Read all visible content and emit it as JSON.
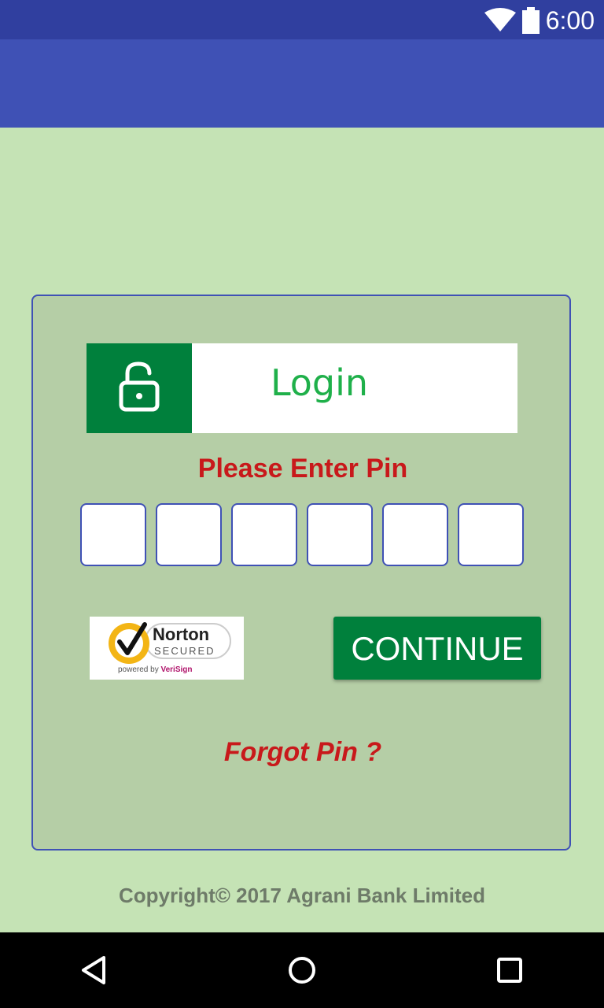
{
  "status_bar": {
    "time": "6:00"
  },
  "login": {
    "title": "Login"
  },
  "pin": {
    "prompt": "Please Enter Pin",
    "boxes": [
      "",
      "",
      "",
      "",
      "",
      ""
    ]
  },
  "norton": {
    "brand": "Norton",
    "secured": "SECURED",
    "powered_by": "powered by",
    "partner": "VeriSign"
  },
  "actions": {
    "continue_label": "CONTINUE",
    "forgot_label": "Forgot Pin ?"
  },
  "footer": {
    "copyright": "Copyright© 2017 Agrani Bank Limited"
  },
  "colors": {
    "primary": "#3f51b5",
    "primary_dark": "#303f9f",
    "green": "#00803c",
    "accent_red": "#c8191b",
    "background": "#c5e3b5",
    "card": "#b5cea6"
  }
}
